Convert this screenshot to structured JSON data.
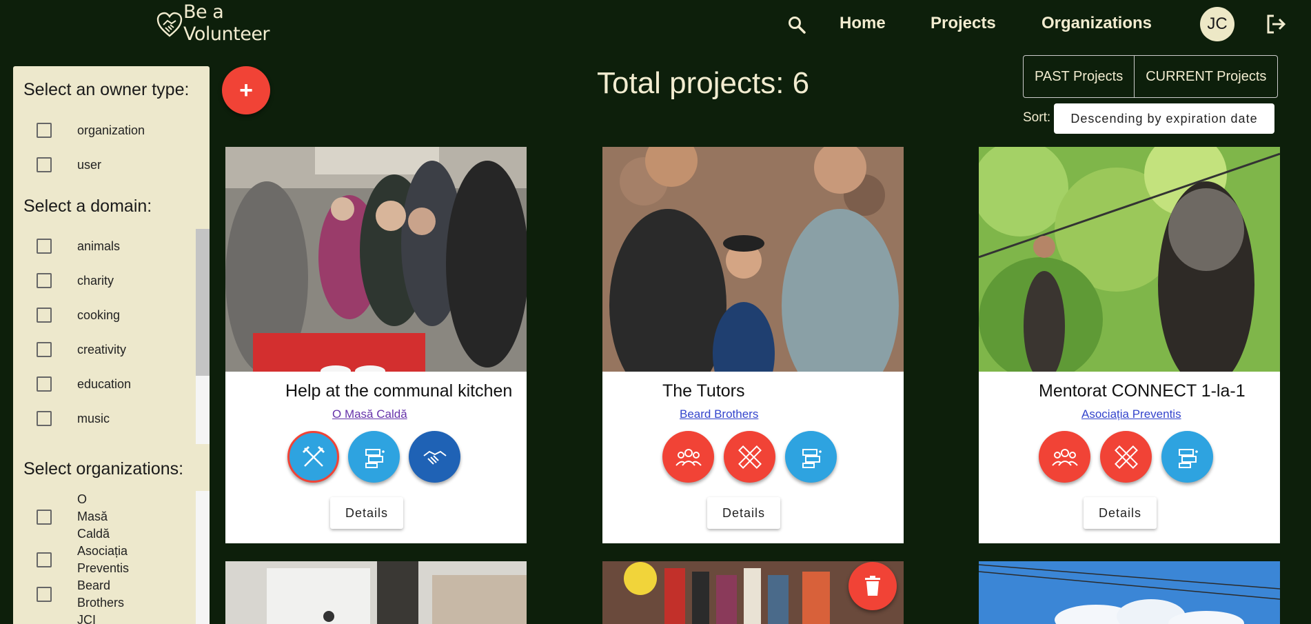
{
  "header": {
    "logo_line1": "Be a",
    "logo_line2": "Volunteer",
    "nav": [
      "Home",
      "Projects",
      "Organizations"
    ],
    "avatar_initials": "JC"
  },
  "sidebar": {
    "owner_heading": "Select an owner type:",
    "owner_types": [
      "organization",
      "user"
    ],
    "domain_heading": "Select a domain:",
    "domains": [
      "animals",
      "charity",
      "cooking",
      "creativity",
      "education",
      "music"
    ],
    "org_heading": "Select organizations:",
    "organizations": [
      "O\nMasă\nCaldă",
      "Asociația\nPreventis",
      "Beard\nBrothers",
      "JCI"
    ]
  },
  "main": {
    "total_label": "Total projects: 6",
    "past_button": "PAST Projects",
    "current_button": "CURRENT Projects",
    "sort_label": "Sort:",
    "sort_value": "Descending by expiration date",
    "details_label": "Details"
  },
  "projects": [
    {
      "title": "Help at the communal kitchen",
      "org": "O Masă Caldă",
      "domains": [
        "cooking-icon",
        "education-icon",
        "charity-icon"
      ]
    },
    {
      "title": "The Tutors",
      "org": "Beard Brothers",
      "domains": [
        "people-icon",
        "creativity-icon",
        "education-icon"
      ]
    },
    {
      "title": "Mentorat CONNECT 1-la-1",
      "org": "Asociația Preventis",
      "domains": [
        "people-icon",
        "creativity-icon",
        "education-icon"
      ]
    }
  ],
  "colors": {
    "background": "#0d1f0b",
    "cream": "#ede8cc",
    "accent_red": "#f14336",
    "blue": "#2ea3e0",
    "dark_blue": "#1f62b5",
    "link_blue": "#3344cc",
    "visited_link": "#6633aa"
  }
}
